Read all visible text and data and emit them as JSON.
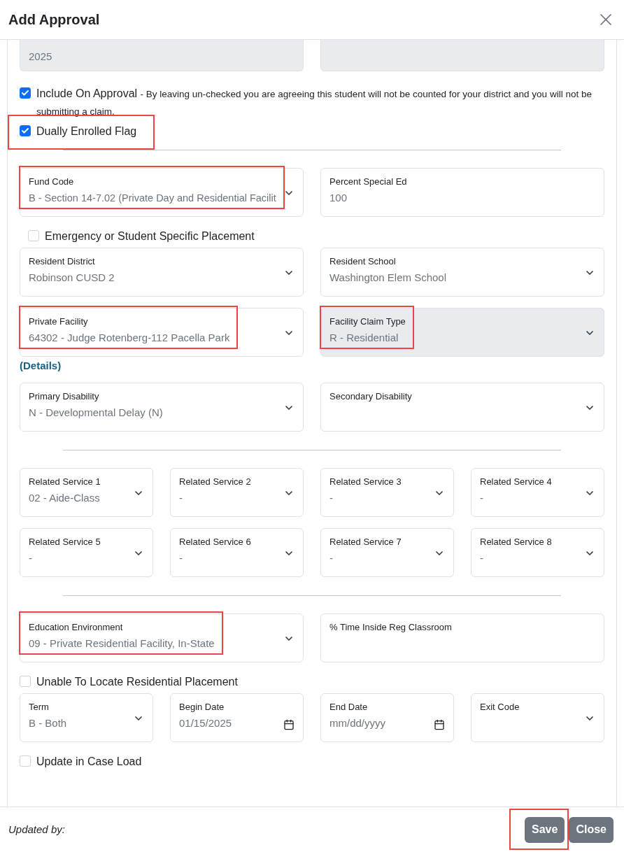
{
  "dialog": {
    "title": "Add Approval"
  },
  "sections": [
    {
      "kind": "fields",
      "fields": [
        {
          "kind": "text",
          "value": "2025",
          "disabled": true
        },
        {
          "kind": "text",
          "disabled": true
        }
      ]
    },
    {
      "kind": "checkbox",
      "label": "Include On Approval",
      "note": "- By leaving un-checked you are agreeing this student will not be counted for your district and you will not be submitting a claim.",
      "checked": true
    },
    {
      "kind": "checkbox",
      "label": "Dually Enrolled Flag",
      "checked": true,
      "highlighted": true
    },
    {
      "kind": "divider"
    },
    {
      "kind": "fields",
      "fields": [
        {
          "kind": "select",
          "label": "Fund Code",
          "value": "B - Section 14-7.02 (Private Day and Residential Facilit",
          "disabled": false,
          "highlighted": true
        },
        {
          "kind": "text",
          "label": "Percent Special Ed",
          "value": "100",
          "disabled": false
        }
      ]
    },
    {
      "kind": "checkbox",
      "label": "Emergency or Student Specific Placement",
      "checked": false,
      "indented": true
    },
    {
      "kind": "fields",
      "fields": [
        {
          "kind": "select",
          "label": "Resident District",
          "value": "Robinson CUSD 2",
          "disabled": false
        },
        {
          "kind": "select",
          "label": "Resident School",
          "value": "Washington Elem School",
          "disabled": false
        }
      ]
    },
    {
      "kind": "fields",
      "fields": [
        {
          "kind": "select",
          "label": "Private Facility",
          "value": "64302 - Judge Rotenberg-112 Pacella Park",
          "disabled": false,
          "highlighted": true
        },
        {
          "kind": "select",
          "label": "Facility Claim Type",
          "value": "R - Residential",
          "disabled": true,
          "highlighted": true
        }
      ]
    },
    {
      "kind": "link",
      "label": "(Details)"
    },
    {
      "kind": "fields",
      "fields": [
        {
          "kind": "select",
          "label": "Primary Disability",
          "value": "N - Developmental Delay (N)",
          "disabled": false
        },
        {
          "kind": "select",
          "label": "Secondary Disability",
          "disabled": false
        }
      ]
    },
    {
      "kind": "divider"
    },
    {
      "kind": "fields",
      "fields": [
        {
          "kind": "select",
          "label": "Related Service 1",
          "value": "02 - Aide-Class",
          "disabled": false
        },
        {
          "kind": "select",
          "label": "Related Service 2",
          "value": "-",
          "disabled": false
        },
        {
          "kind": "select",
          "label": "Related Service 3",
          "value": "-",
          "disabled": false
        },
        {
          "kind": "select",
          "label": "Related Service 4",
          "value": "-",
          "disabled": false
        }
      ]
    },
    {
      "kind": "fields",
      "fields": [
        {
          "kind": "select",
          "label": "Related Service 5",
          "value": "-",
          "disabled": false
        },
        {
          "kind": "select",
          "label": "Related Service 6",
          "value": "-",
          "disabled": false
        },
        {
          "kind": "select",
          "label": "Related Service 7",
          "value": "-",
          "disabled": false
        },
        {
          "kind": "select",
          "label": "Related Service 8",
          "value": "-",
          "disabled": false
        }
      ]
    },
    {
      "kind": "divider"
    },
    {
      "kind": "fields",
      "fields": [
        {
          "kind": "select",
          "label": "Education Environment",
          "value": "09 - Private Residential Facility, In-State",
          "disabled": false,
          "highlighted": true
        },
        {
          "kind": "text",
          "label": "% Time Inside Reg Classroom",
          "disabled": false
        }
      ]
    },
    {
      "kind": "checkbox",
      "label": "Unable To Locate Residential Placement",
      "checked": false
    },
    {
      "kind": "fields",
      "fields": [
        {
          "kind": "select",
          "label": "Term",
          "value": "B - Both",
          "disabled": false
        },
        {
          "kind": "date",
          "label": "Begin Date",
          "value": "01/15/2025",
          "disabled": false
        },
        {
          "kind": "date",
          "label": "End Date",
          "placeholder": "mm/dd/yyyy",
          "disabled": false
        },
        {
          "kind": "select",
          "label": "Exit Code",
          "disabled": false
        }
      ]
    },
    {
      "kind": "checkbox",
      "label": "Update in Case Load",
      "checked": false
    }
  ],
  "footer": {
    "updated_by": "Updated by:",
    "buttons": [
      {
        "label": "Save",
        "highlighted": true
      },
      {
        "label": "Close"
      }
    ]
  }
}
